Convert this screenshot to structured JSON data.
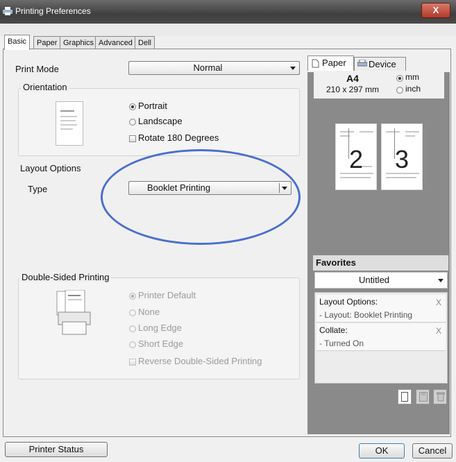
{
  "window": {
    "title": "Printing Preferences",
    "close_label": "X"
  },
  "tabs": [
    "Basic",
    "Paper",
    "Graphics",
    "Advanced",
    "Dell"
  ],
  "print_mode": {
    "label": "Print Mode",
    "value": "Normal"
  },
  "orientation": {
    "legend": "Orientation",
    "options": [
      "Portrait",
      "Landscape"
    ],
    "selected": "Portrait",
    "rotate_label": "Rotate 180 Degrees"
  },
  "layout": {
    "legend": "Layout Options",
    "type_label": "Type",
    "type_value": "Booklet Printing"
  },
  "duplex": {
    "legend": "Double-Sided Printing",
    "options": [
      "Printer Default",
      "None",
      "Long Edge",
      "Short Edge"
    ],
    "selected": "Printer Default",
    "reverse_label": "Reverse Double-Sided Printing"
  },
  "preview": {
    "tabs": [
      "Paper",
      "Device"
    ],
    "paper_size": "A4",
    "dimensions": "210 x 297 mm",
    "units": [
      "mm",
      "inch"
    ],
    "selected_unit": "mm",
    "pages": [
      "2",
      "3"
    ]
  },
  "favorites": {
    "title": "Favorites",
    "selected": "Untitled",
    "items": [
      {
        "heading": "Layout Options:",
        "detail": "- Layout: Booklet Printing"
      },
      {
        "heading": "Collate:",
        "detail": "- Turned On"
      }
    ],
    "remove_label": "X"
  },
  "buttons": {
    "printer_status": "Printer Status",
    "ok": "OK",
    "cancel": "Cancel"
  },
  "colors": {
    "highlight_ellipse": "#4a6fd0",
    "preview_panel": "#8a8a8a"
  }
}
